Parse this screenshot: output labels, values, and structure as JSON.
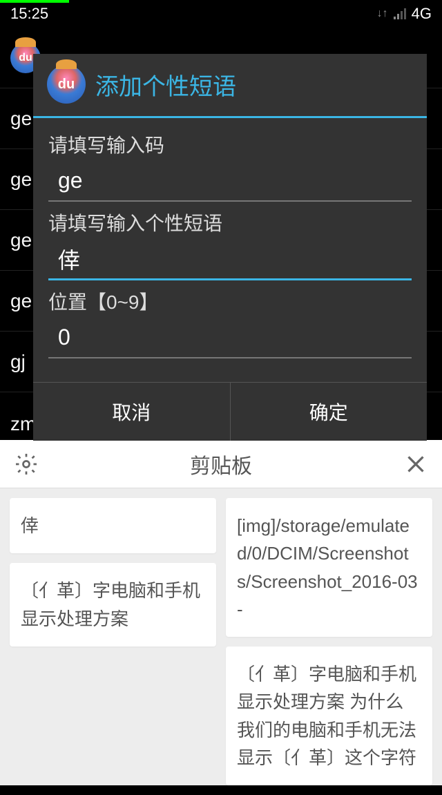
{
  "status": {
    "time": "15:25",
    "network": "4G"
  },
  "bg_list": [
    "ge",
    "ge",
    "ge",
    "ge",
    "gj",
    "zmgjr=最美倖家人"
  ],
  "dialog": {
    "title": "添加个性短语",
    "field1_label": "请填写输入码",
    "field1_value": "ge",
    "field2_label": "请填写输入个性短语",
    "field2_value": "倖",
    "field3_label": "位置【0~9】",
    "field3_value": "0",
    "cancel": "取消",
    "ok": "确定"
  },
  "clipboard": {
    "title": "剪贴板",
    "items_left": [
      "倖",
      "〔亻革〕字电脑和手机显示处理方案"
    ],
    "items_right": [
      "[img]/storage/emulated/0/DCIM/Screenshots/Screenshot_2016-03-",
      "〔亻革〕字电脑和手机显示处理方案 为什么我们的电脑和手机无法显示〔亻革〕这个字符"
    ]
  }
}
